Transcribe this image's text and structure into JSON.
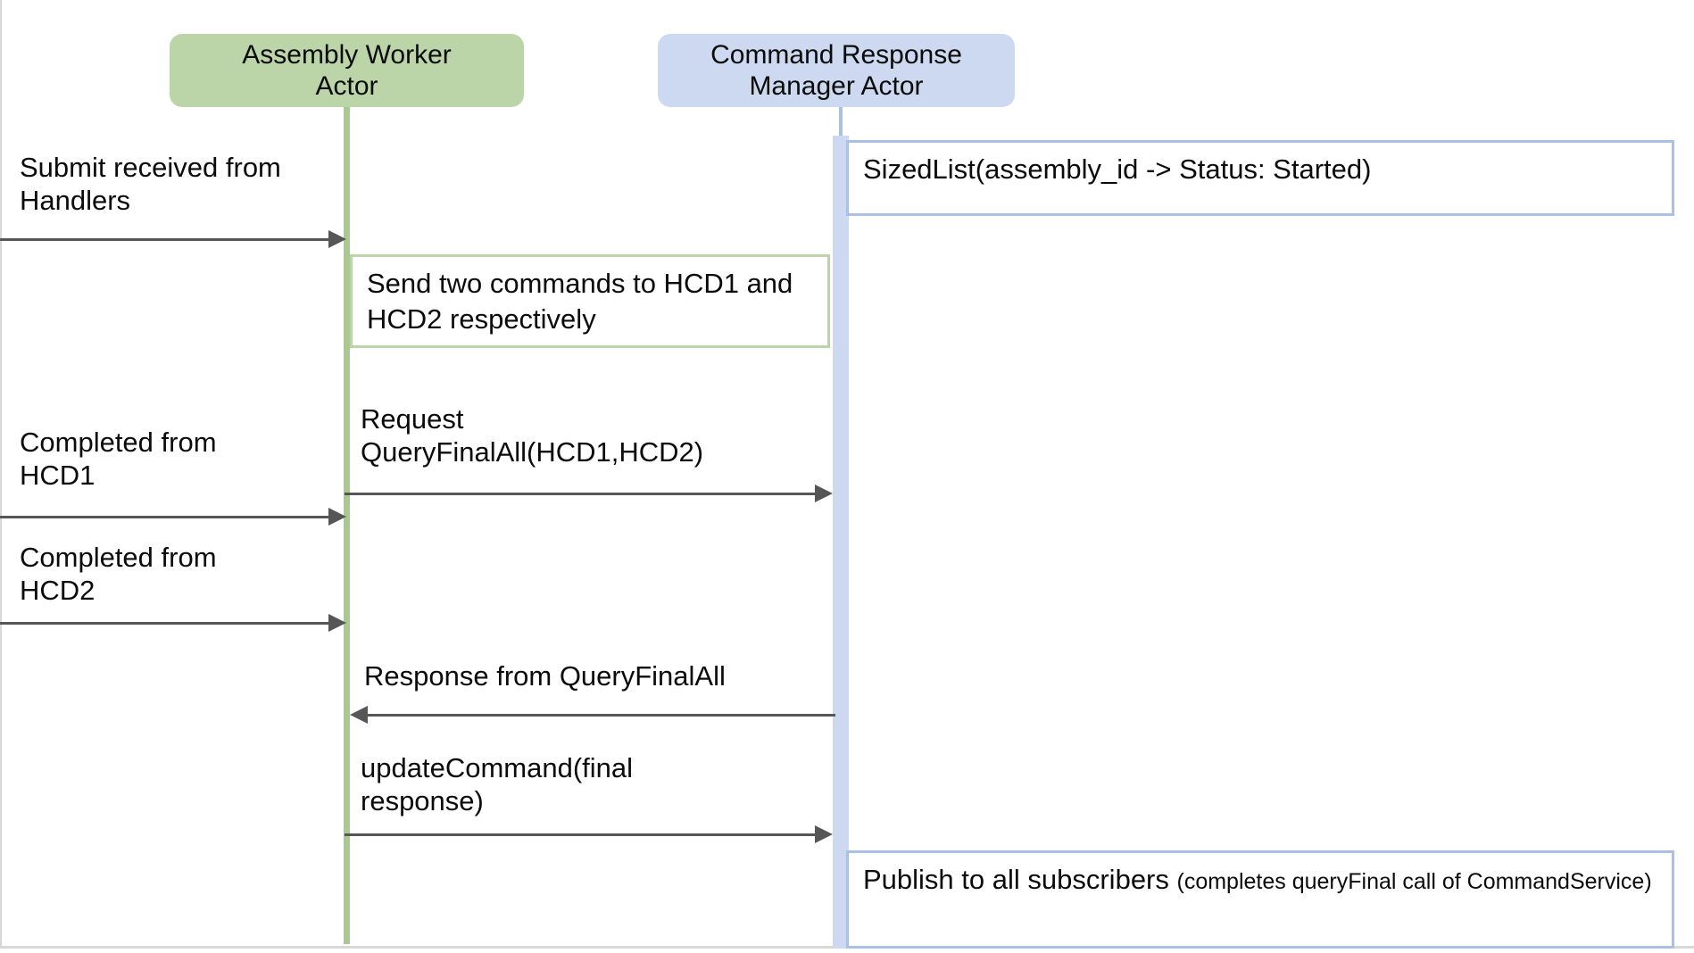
{
  "diagram": {
    "kind": "uml-sequence-diagram",
    "colors": {
      "green_fill": "#bcd5a8",
      "green_stroke": "#a9c98f",
      "blue_fill": "#ccd9f0",
      "blue_stroke": "#aac0e4",
      "arrow": "#565656",
      "text": "#0b0b0b",
      "background": "#ffffff"
    }
  },
  "participants": [
    {
      "id": "assembly_worker",
      "label": "Assembly Worker\nActor",
      "color": "green"
    },
    {
      "id": "command_response_manager",
      "label": "Command Response\nManager Actor",
      "color": "blue"
    }
  ],
  "notes": [
    {
      "id": "sized_list_note",
      "text": "SizedList(assembly_id -> Status: Started)",
      "owner": "command_response_manager",
      "color": "blue"
    },
    {
      "id": "send_two_commands_note",
      "text": "Send two commands to HCD1\nand HCD2 respectively",
      "owner": "assembly_worker",
      "color": "green"
    },
    {
      "id": "publish_note",
      "text_main": "Publish to all subscribers ",
      "text_small": "(completes queryFinal call of CommandService)",
      "owner": "command_response_manager",
      "color": "blue"
    }
  ],
  "messages": [
    {
      "id": "submit_received",
      "label": "Submit received from\nHandlers",
      "from": "external-left",
      "to": "assembly_worker",
      "direction": "right"
    },
    {
      "id": "completed_hcd1",
      "label": "Completed from\nHCD1",
      "from": "external-left",
      "to": "assembly_worker",
      "direction": "right"
    },
    {
      "id": "request_query_final_all",
      "label": "Request\nQueryFinalAll(HCD1,HCD2)",
      "from": "assembly_worker",
      "to": "command_response_manager",
      "direction": "right"
    },
    {
      "id": "completed_hcd2",
      "label": "Completed from\nHCD2",
      "from": "external-left",
      "to": "assembly_worker",
      "direction": "right"
    },
    {
      "id": "response_query_final_all",
      "label": "Response from QueryFinalAll",
      "from": "command_response_manager",
      "to": "assembly_worker",
      "direction": "left"
    },
    {
      "id": "update_command",
      "label": "updateCommand(final\nresponse)",
      "from": "assembly_worker",
      "to": "command_response_manager",
      "direction": "right"
    }
  ]
}
